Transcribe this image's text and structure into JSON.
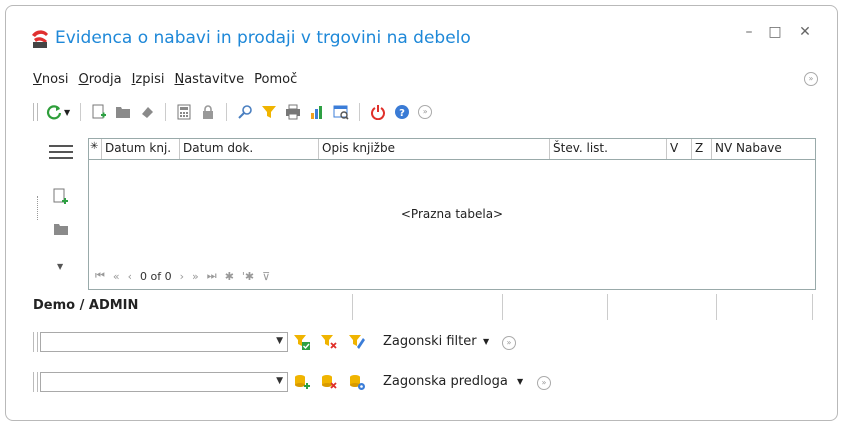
{
  "window": {
    "title": "Evidenca o nabavi in prodaji v trgovini na debelo",
    "minimize": "–",
    "maximize": "□",
    "close": "✕"
  },
  "menu": {
    "items": [
      "Vnosi",
      "Orodja",
      "Izpisi",
      "Nastavitve",
      "Pomoč"
    ],
    "underline": [
      "V",
      "O",
      "I",
      "N",
      ""
    ]
  },
  "grid": {
    "columns": [
      "✳",
      "Datum knj.",
      "Datum dok.",
      "Opis knjižbe",
      "Štev. list.",
      "V",
      "Z",
      "NV Nabave"
    ],
    "empty_text": "<Prazna tabela>",
    "record_count": "0 of 0"
  },
  "status": {
    "user": "Demo / ADMIN"
  },
  "filter": {
    "combo_value": "",
    "label": "Zagonski filter"
  },
  "template": {
    "combo_value": "",
    "label": "Zagonska predloga"
  },
  "colors": {
    "title": "#1e88d8",
    "refresh": "#2e9e3a",
    "filter": "#f0b400",
    "power": "#e0302a",
    "help": "#3a7bd5",
    "chart": "#3b7dd8"
  }
}
